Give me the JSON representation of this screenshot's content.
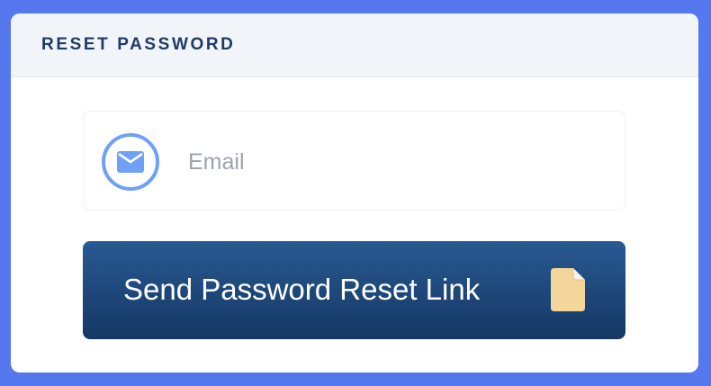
{
  "panel": {
    "title": "RESET PASSWORD"
  },
  "form": {
    "email": {
      "placeholder": "Email",
      "value": "",
      "icon": "envelope-icon"
    },
    "submit": {
      "label": "Send Password Reset Link",
      "icon": "document-icon"
    }
  },
  "colors": {
    "background": "#5578ef",
    "header_background": "#f1f5fa",
    "title": "#1f3a66",
    "icon_accent": "#6ea0f6",
    "button_top": "#285a92",
    "button_bottom": "#153764",
    "document_icon": "#f4d69a"
  }
}
